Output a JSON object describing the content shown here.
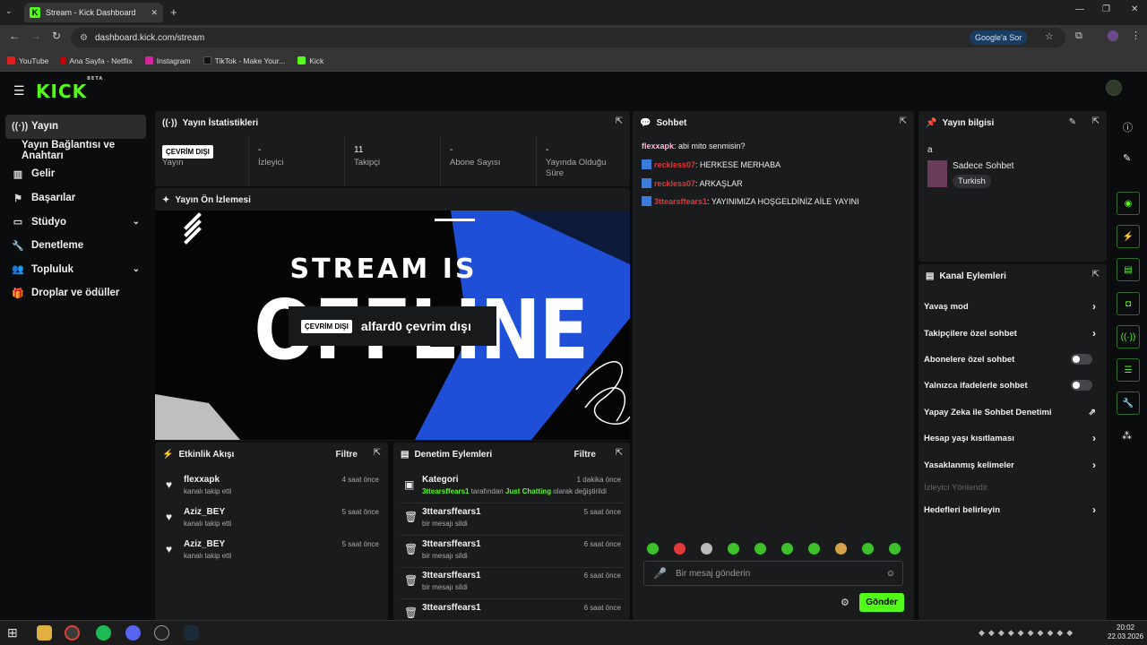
{
  "browser": {
    "tab_title": "Stream - Kick Dashboard",
    "url": "dashboard.kick.com/stream",
    "google_btn": "Google'a Sor",
    "bookmarks": [
      "YouTube",
      "Ana Sayfa - Netflix",
      "Instagram",
      "TikTok - Make Your...",
      "Kick"
    ]
  },
  "app": {
    "logo": "KICK",
    "logo_sup": "BETA"
  },
  "sidebar": {
    "items": [
      "Yayın",
      "Yayın Bağlantısı ve Anahtarı",
      "Gelir",
      "Başarılar",
      "Stüdyo",
      "Denetleme",
      "Topluluk",
      "Droplar ve ödüller"
    ]
  },
  "stats": {
    "title": "Yayın İstatistikleri",
    "status_chip": "ÇEVRİM DIŞI",
    "items": [
      {
        "value": "",
        "label": "Yayın"
      },
      {
        "value": "-",
        "label": "İzleyici"
      },
      {
        "value": "11",
        "label": "Takipçi"
      },
      {
        "value": "-",
        "label": "Abone Sayısı"
      },
      {
        "value": "-",
        "label": "Yayında Olduğu Süre"
      }
    ]
  },
  "preview": {
    "title": "Yayın Ön İzlemesi",
    "line1": "STREAM IS",
    "line2": "OFFLINE",
    "chip": "ÇEVRİM DIŞI",
    "overlay": "alfard0 çevrim dışı"
  },
  "activity": {
    "title": "Etkinlik Akışı",
    "filter": "Filtre",
    "items": [
      {
        "name": "flexxapk",
        "sub": "kanalı takip etti",
        "time": "4 saat önce"
      },
      {
        "name": "Aziz_BEY",
        "sub": "kanalı takip etti",
        "time": "5 saat önce"
      },
      {
        "name": "Aziz_BEY",
        "sub": "kanalı takip etti",
        "time": "5 saat önce"
      }
    ]
  },
  "moderation": {
    "title": "Denetim Eylemleri",
    "filter": "Filtre",
    "first": {
      "name": "Kategori",
      "time": "1 dakika önce",
      "user": "3ttearsffears1",
      "mid": " tarafından ",
      "cat": "Just Chatting",
      "tail": " olarak değiştirildi"
    },
    "items": [
      {
        "name": "3ttearsffears1",
        "sub": "bir mesajı sildi",
        "time": "5 saat önce"
      },
      {
        "name": "3ttearsffears1",
        "sub": "bir mesajı sildi",
        "time": "6 saat önce"
      },
      {
        "name": "3ttearsffears1",
        "sub": "bir mesajı sildi",
        "time": "6 saat önce"
      },
      {
        "name": "3ttearsffears1",
        "sub": "",
        "time": "6 saat önce"
      }
    ]
  },
  "chat": {
    "title": "Sohbet",
    "placeholder": "Bir mesaj gönderin",
    "send": "Gönder",
    "messages": [
      {
        "user": "flexxapk",
        "text": ": abi mito senmisin?",
        "color": "#ffb3d9",
        "badge": false
      },
      {
        "user": "reckless07",
        "text": ": HERKESE MERHABA",
        "color": "#e03a3a",
        "badge": true
      },
      {
        "user": "reckless07",
        "text": ": ARKAŞLAR",
        "color": "#e03a3a",
        "badge": true
      },
      {
        "user": "3ttearsffears1",
        "text": ": YAYINIMIZA HOŞGELDİNİZ AİLE YAYINI",
        "color": "#e03a3a",
        "badge": true
      }
    ]
  },
  "info": {
    "title": "Yayın bilgisi",
    "stream_title": "a",
    "category": "Sadece Sohbet",
    "tag": "Turkish"
  },
  "channel_actions": {
    "title": "Kanal Eylemleri",
    "items": [
      {
        "label": "Yavaş mod",
        "kind": "arrow"
      },
      {
        "label": "Takipçilere özel sohbet",
        "kind": "arrow"
      },
      {
        "label": "Abonelere özel sohbet",
        "kind": "toggle"
      },
      {
        "label": "Yalnızca ifadelerle sohbet",
        "kind": "toggle"
      },
      {
        "label": "Yapay Zeka ile Sohbet Denetimi",
        "kind": "link"
      },
      {
        "label": "Hesap yaşı kısıtlaması",
        "kind": "arrow"
      },
      {
        "label": "Yasaklanmış kelimeler",
        "kind": "arrow"
      },
      {
        "label": "İzleyici Yönlendir",
        "kind": "disabled"
      },
      {
        "label": "Hedefleri belirleyin",
        "kind": "arrow"
      }
    ]
  },
  "clock": {
    "time": "20:02",
    "date": "22.03.2026"
  }
}
